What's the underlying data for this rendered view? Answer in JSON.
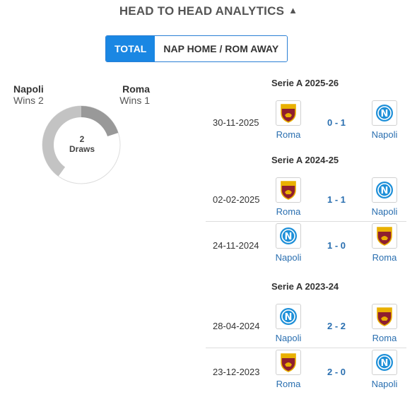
{
  "header": {
    "title": "HEAD TO HEAD ANALYTICS",
    "toggle_icon": "chevron-up-icon"
  },
  "tabs": [
    {
      "label": "TOTAL",
      "active": true
    },
    {
      "label": "NAP HOME / ROM AWAY",
      "active": false
    }
  ],
  "summary": {
    "left": {
      "name": "Napoli",
      "wins": "Wins 2"
    },
    "right": {
      "name": "Roma",
      "wins": "Wins 1"
    },
    "draws_count": "2",
    "draws_label": "Draws",
    "segments": {
      "napoli_wins": 2,
      "roma_wins": 1,
      "draws": 2
    },
    "colors": {
      "napoli": "#c3c3c3",
      "roma": "#999999",
      "draws": "#e6e6e6"
    }
  },
  "seasons": [
    {
      "name": "Serie A 2025-26",
      "matches": [
        {
          "date": "30-11-2025",
          "home": "Roma",
          "home_logo": "roma-crest-icon",
          "score_home": "0",
          "score_away": "1",
          "away": "Napoli",
          "away_logo": "napoli-crest-icon"
        }
      ]
    },
    {
      "name": "Serie A 2024-25",
      "matches": [
        {
          "date": "02-02-2025",
          "home": "Roma",
          "home_logo": "roma-crest-icon",
          "score_home": "1",
          "score_away": "1",
          "away": "Napoli",
          "away_logo": "napoli-crest-icon"
        },
        {
          "date": "24-11-2024",
          "home": "Napoli",
          "home_logo": "napoli-crest-icon",
          "score_home": "1",
          "score_away": "0",
          "away": "Roma",
          "away_logo": "roma-crest-icon"
        }
      ]
    },
    {
      "name": "Serie A 2023-24",
      "matches": [
        {
          "date": "28-04-2024",
          "home": "Napoli",
          "home_logo": "napoli-crest-icon",
          "score_home": "2",
          "score_away": "2",
          "away": "Roma",
          "away_logo": "roma-crest-icon"
        },
        {
          "date": "23-12-2023",
          "home": "Roma",
          "home_logo": "roma-crest-icon",
          "score_home": "2",
          "score_away": "0",
          "away": "Napoli",
          "away_logo": "napoli-crest-icon"
        }
      ]
    }
  ]
}
